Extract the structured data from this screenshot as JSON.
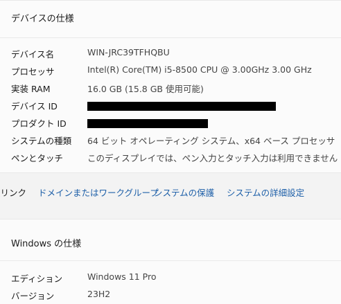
{
  "device_specs": {
    "header": "デバイスの仕様",
    "rows": [
      {
        "label": "デバイス名",
        "value": "WIN-JRC39TFHQBU"
      },
      {
        "label": "プロセッサ",
        "value": "Intel(R) Core(TM) i5-8500 CPU @ 3.00GHz   3.00 GHz"
      },
      {
        "label": "実装 RAM",
        "value": "16.0 GB (15.8 GB 使用可能)"
      },
      {
        "label": "デバイス ID",
        "value": ""
      },
      {
        "label": "プロダクト ID",
        "value": ""
      },
      {
        "label": "システムの種類",
        "value": "64 ビット オペレーティング システム、x64 ベース プロセッサ"
      },
      {
        "label": "ペンとタッチ",
        "value": "このディスプレイでは、ペン入力とタッチ入力は利用できません"
      }
    ]
  },
  "related_links": {
    "label": "連リンク",
    "items": [
      {
        "label": "ドメインまたはワークグループ"
      },
      {
        "label": "システムの保護"
      },
      {
        "label": "システムの詳細設定"
      }
    ]
  },
  "windows_specs": {
    "header": "Windows の仕様",
    "rows": [
      {
        "label": "エディション",
        "value": "Windows 11 Pro"
      },
      {
        "label": "バージョン",
        "value": "23H2"
      }
    ]
  }
}
